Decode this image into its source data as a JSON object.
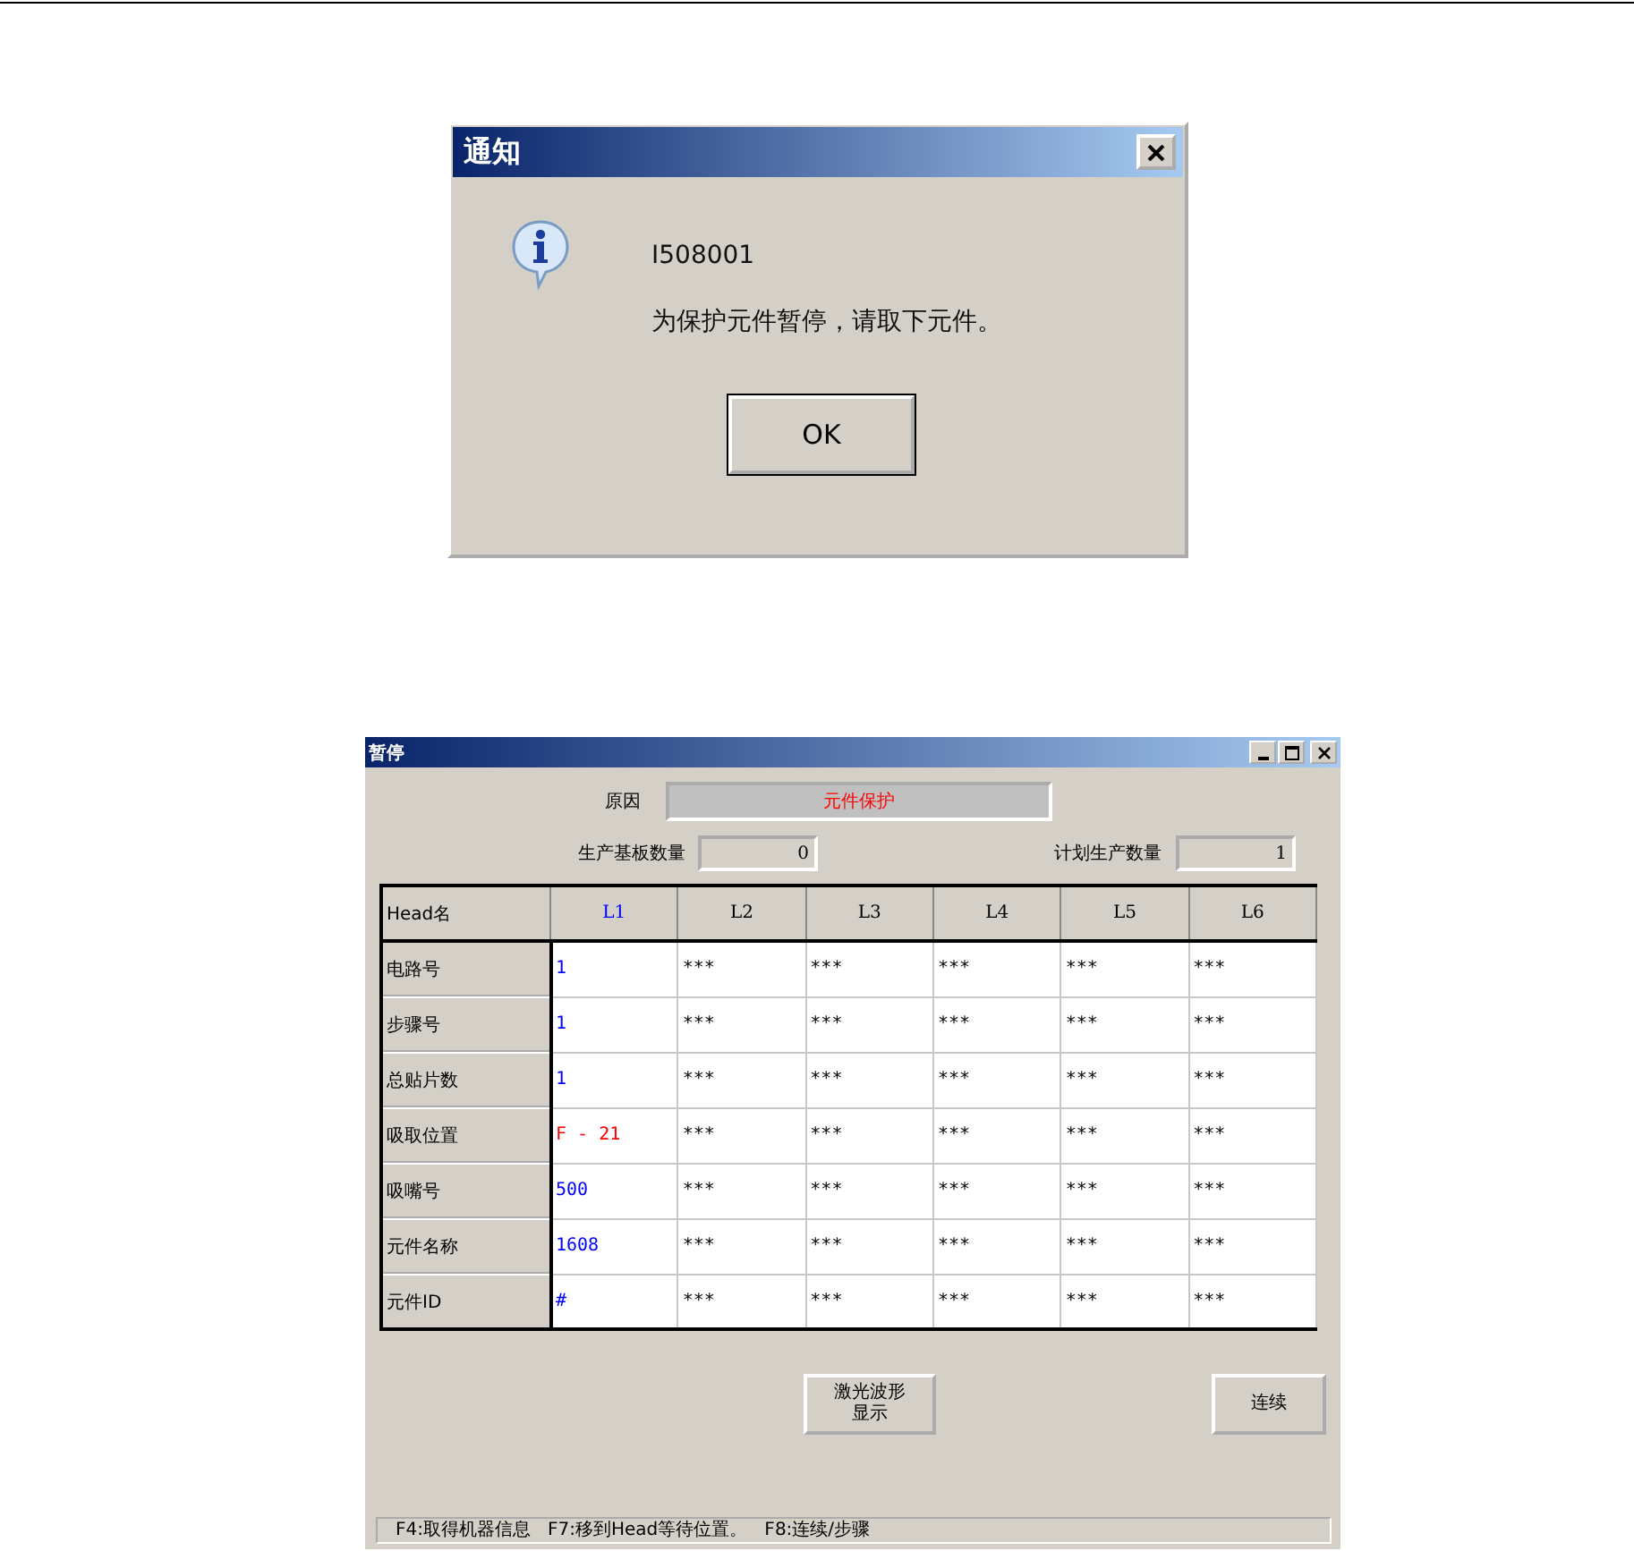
{
  "notice_dialog": {
    "title": "通知",
    "code": "I508001",
    "message": "为保护元件暂停，请取下元件。",
    "button": "OK"
  },
  "pause_window": {
    "title": "暂停",
    "reason": {
      "label": "原因",
      "value": "元件保护"
    },
    "produced": {
      "label": "生产基板数量",
      "value": "0"
    },
    "planned": {
      "label": "计划生产数量",
      "value": "1"
    },
    "table": {
      "corner": "Head名",
      "columns": [
        {
          "label": "L1",
          "selected": true
        },
        {
          "label": "L2",
          "selected": false
        },
        {
          "label": "L3",
          "selected": false
        },
        {
          "label": "L4",
          "selected": false
        },
        {
          "label": "L5",
          "selected": false
        },
        {
          "label": "L6",
          "selected": false
        }
      ],
      "rows": [
        {
          "label": "电路号",
          "color": "#0000ff",
          "values": [
            "1",
            "***",
            "***",
            "***",
            "***",
            "***"
          ]
        },
        {
          "label": "步骤号",
          "color": "#0000ff",
          "values": [
            "1",
            "***",
            "***",
            "***",
            "***",
            "***"
          ]
        },
        {
          "label": "总贴片数",
          "color": "#0000ff",
          "values": [
            "1",
            "***",
            "***",
            "***",
            "***",
            "***"
          ]
        },
        {
          "label": "吸取位置",
          "color": "#ff0000",
          "values": [
            "F - 21",
            "***",
            "***",
            "***",
            "***",
            "***"
          ]
        },
        {
          "label": "吸嘴号",
          "color": "#0000ff",
          "values": [
            "500",
            "***",
            "***",
            "***",
            "***",
            "***"
          ]
        },
        {
          "label": "元件名称",
          "color": "#0000ff",
          "values": [
            "1608",
            "***",
            "***",
            "***",
            "***",
            "***"
          ]
        },
        {
          "label": "元件ID",
          "color": "#0000ff",
          "values": [
            "#",
            "***",
            "***",
            "***",
            "***",
            "***"
          ]
        }
      ]
    },
    "buttons": [
      "激光波形显示",
      "连续"
    ],
    "status": "F4:取得机器信息   F7:移到Head等待位置。   F8:连续/步骤"
  }
}
